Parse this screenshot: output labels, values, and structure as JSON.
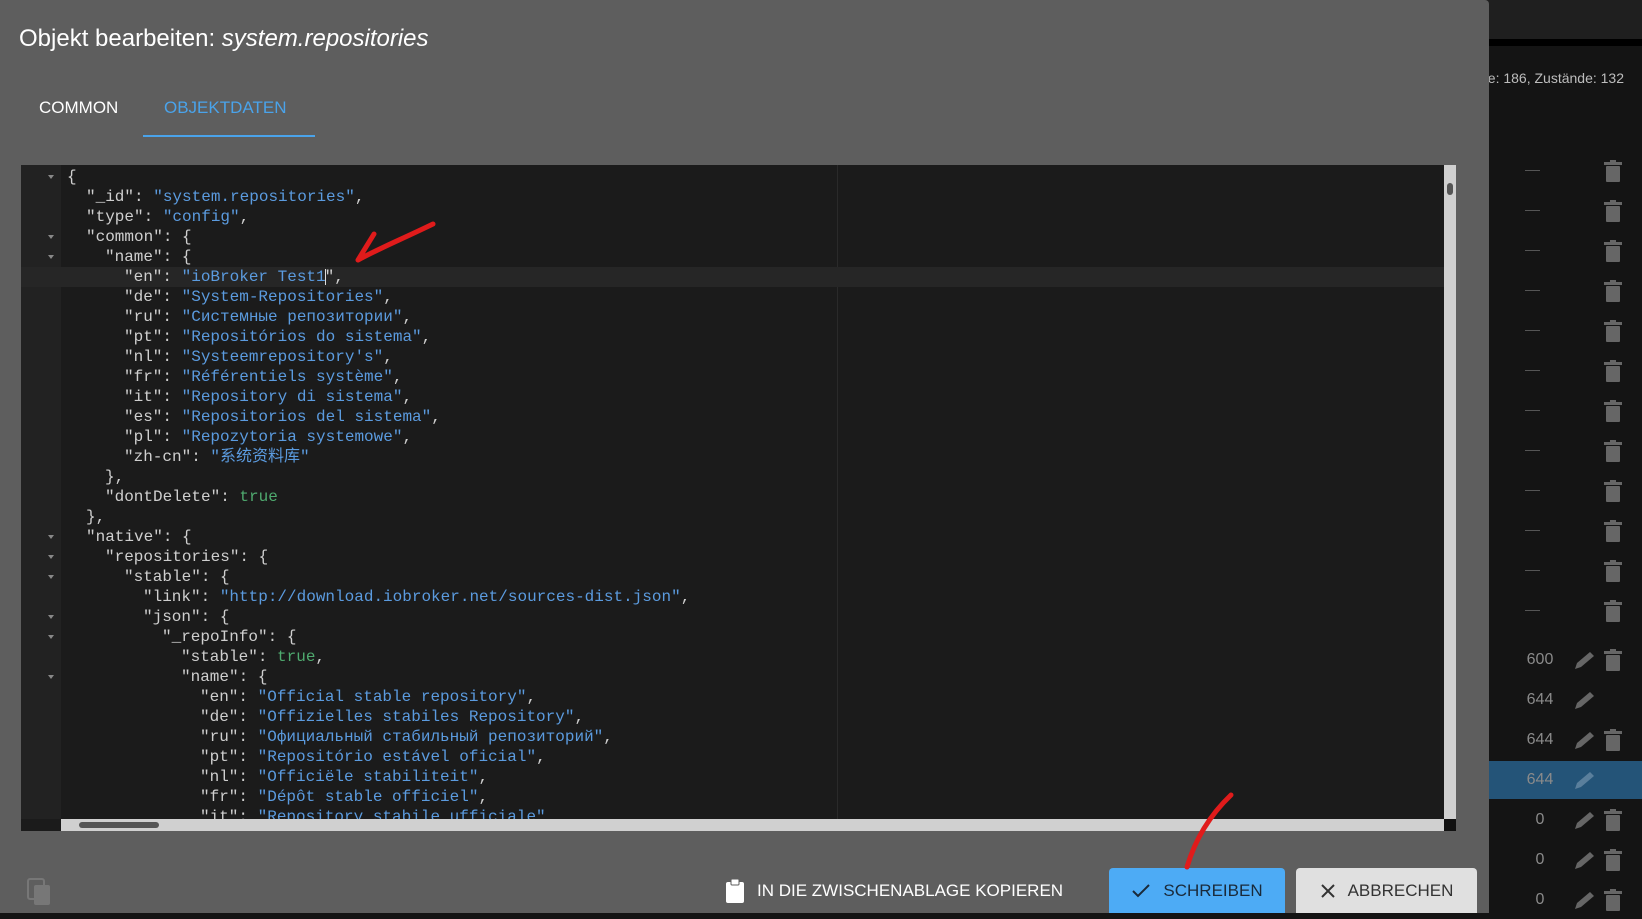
{
  "background": {
    "stats": "e: 186, Zustände: 132",
    "rows": [
      {
        "value": "—",
        "pencil": false,
        "trash": true
      },
      {
        "value": "—",
        "pencil": false,
        "trash": true
      },
      {
        "value": "—",
        "pencil": false,
        "trash": true
      },
      {
        "value": "—",
        "pencil": false,
        "trash": true
      },
      {
        "value": "—",
        "pencil": false,
        "trash": true
      },
      {
        "value": "—",
        "pencil": false,
        "trash": true
      },
      {
        "value": "—",
        "pencil": false,
        "trash": true
      },
      {
        "value": "—",
        "pencil": false,
        "trash": true
      },
      {
        "value": "—",
        "pencil": false,
        "trash": true
      },
      {
        "value": "—",
        "pencil": false,
        "trash": true
      },
      {
        "value": "—",
        "pencil": false,
        "trash": true
      },
      {
        "value": "—",
        "pencil": false,
        "trash": true
      },
      {
        "value": "600",
        "pencil": true,
        "trash": true
      },
      {
        "value": "644",
        "pencil": true,
        "trash": false
      },
      {
        "value": "644",
        "pencil": true,
        "trash": true
      },
      {
        "value": "644",
        "pencil": true,
        "trash": false,
        "selected": true
      },
      {
        "value": "0",
        "pencil": true,
        "trash": true
      },
      {
        "value": "0",
        "pencil": true,
        "trash": true
      },
      {
        "value": "0",
        "pencil": true,
        "trash": true
      }
    ],
    "selected_color": "#245478"
  },
  "dialog": {
    "title_prefix": "Objekt bearbeiten: ",
    "title_object": "system.repositories",
    "tabs": [
      {
        "label": "COMMON",
        "active": false
      },
      {
        "label": "OBJEKTDATEN",
        "active": true
      }
    ],
    "accent": "#4aa3ea",
    "editor": {
      "cursor_line": 6,
      "lines": [
        {
          "indent": 0,
          "key": "",
          "val": "",
          "kind": "",
          "end": "{"
        },
        {
          "indent": 1,
          "key": "\"_id\"",
          "val": "\"system.repositories\"",
          "kind": "s",
          "end": ","
        },
        {
          "indent": 1,
          "key": "\"type\"",
          "val": "\"config\"",
          "kind": "s",
          "end": ","
        },
        {
          "indent": 1,
          "key": "\"common\"",
          "val": "",
          "kind": "",
          "end": "{"
        },
        {
          "indent": 2,
          "key": "\"name\"",
          "val": "",
          "kind": "",
          "end": "{"
        },
        {
          "indent": 3,
          "key": "\"en\"",
          "val": "\"ioBroker Test1",
          "kind": "s",
          "end": "\","
        },
        {
          "indent": 3,
          "key": "\"de\"",
          "val": "\"System-Repositories\"",
          "kind": "s",
          "end": ","
        },
        {
          "indent": 3,
          "key": "\"ru\"",
          "val": "\"Системные репозитории\"",
          "kind": "s",
          "end": ","
        },
        {
          "indent": 3,
          "key": "\"pt\"",
          "val": "\"Repositórios do sistema\"",
          "kind": "s",
          "end": ","
        },
        {
          "indent": 3,
          "key": "\"nl\"",
          "val": "\"Systeemrepository's\"",
          "kind": "s",
          "end": ","
        },
        {
          "indent": 3,
          "key": "\"fr\"",
          "val": "\"Référentiels système\"",
          "kind": "s",
          "end": ","
        },
        {
          "indent": 3,
          "key": "\"it\"",
          "val": "\"Repository di sistema\"",
          "kind": "s",
          "end": ","
        },
        {
          "indent": 3,
          "key": "\"es\"",
          "val": "\"Repositorios del sistema\"",
          "kind": "s",
          "end": ","
        },
        {
          "indent": 3,
          "key": "\"pl\"",
          "val": "\"Repozytoria systemowe\"",
          "kind": "s",
          "end": ","
        },
        {
          "indent": 3,
          "key": "\"zh-cn\"",
          "val": "\"系统资料库\"",
          "kind": "s",
          "end": ""
        },
        {
          "indent": 2,
          "key": "",
          "val": "",
          "kind": "",
          "end": "},"
        },
        {
          "indent": 2,
          "key": "\"dontDelete\"",
          "val": "true",
          "kind": "b",
          "end": ""
        },
        {
          "indent": 1,
          "key": "",
          "val": "",
          "kind": "",
          "end": "},"
        },
        {
          "indent": 1,
          "key": "\"native\"",
          "val": "",
          "kind": "",
          "end": "{"
        },
        {
          "indent": 2,
          "key": "\"repositories\"",
          "val": "",
          "kind": "",
          "end": "{"
        },
        {
          "indent": 3,
          "key": "\"stable\"",
          "val": "",
          "kind": "",
          "end": "{"
        },
        {
          "indent": 4,
          "key": "\"link\"",
          "val": "\"http://download.iobroker.net/sources-dist.json\"",
          "kind": "s",
          "end": ","
        },
        {
          "indent": 4,
          "key": "\"json\"",
          "val": "",
          "kind": "",
          "end": "{"
        },
        {
          "indent": 5,
          "key": "\"_repoInfo\"",
          "val": "",
          "kind": "",
          "end": "{"
        },
        {
          "indent": 6,
          "key": "\"stable\"",
          "val": "true",
          "kind": "b",
          "end": ","
        },
        {
          "indent": 6,
          "key": "\"name\"",
          "val": "",
          "kind": "",
          "end": "{"
        },
        {
          "indent": 7,
          "key": "\"en\"",
          "val": "\"Official stable repository\"",
          "kind": "s",
          "end": ","
        },
        {
          "indent": 7,
          "key": "\"de\"",
          "val": "\"Offizielles stabiles Repository\"",
          "kind": "s",
          "end": ","
        },
        {
          "indent": 7,
          "key": "\"ru\"",
          "val": "\"Официальный стабильный репозиторий\"",
          "kind": "s",
          "end": ","
        },
        {
          "indent": 7,
          "key": "\"pt\"",
          "val": "\"Repositório estável oficial\"",
          "kind": "s",
          "end": ","
        },
        {
          "indent": 7,
          "key": "\"nl\"",
          "val": "\"Officiële stabiliteit\"",
          "kind": "s",
          "end": ","
        },
        {
          "indent": 7,
          "key": "\"fr\"",
          "val": "\"Dépôt stable officiel\"",
          "kind": "s",
          "end": ","
        },
        {
          "indent": 7,
          "key": "\"it\"",
          "val": "\"Repository stabile ufficiale\"",
          "kind": "s",
          "end": ","
        }
      ]
    },
    "buttons": {
      "copy": "IN DIE ZWISCHENABLAGE KOPIEREN",
      "write": "SCHREIBEN",
      "cancel": "ABBRECHEN"
    },
    "write_color": "#4dabf5",
    "annotation_color": "#e01b1b"
  }
}
